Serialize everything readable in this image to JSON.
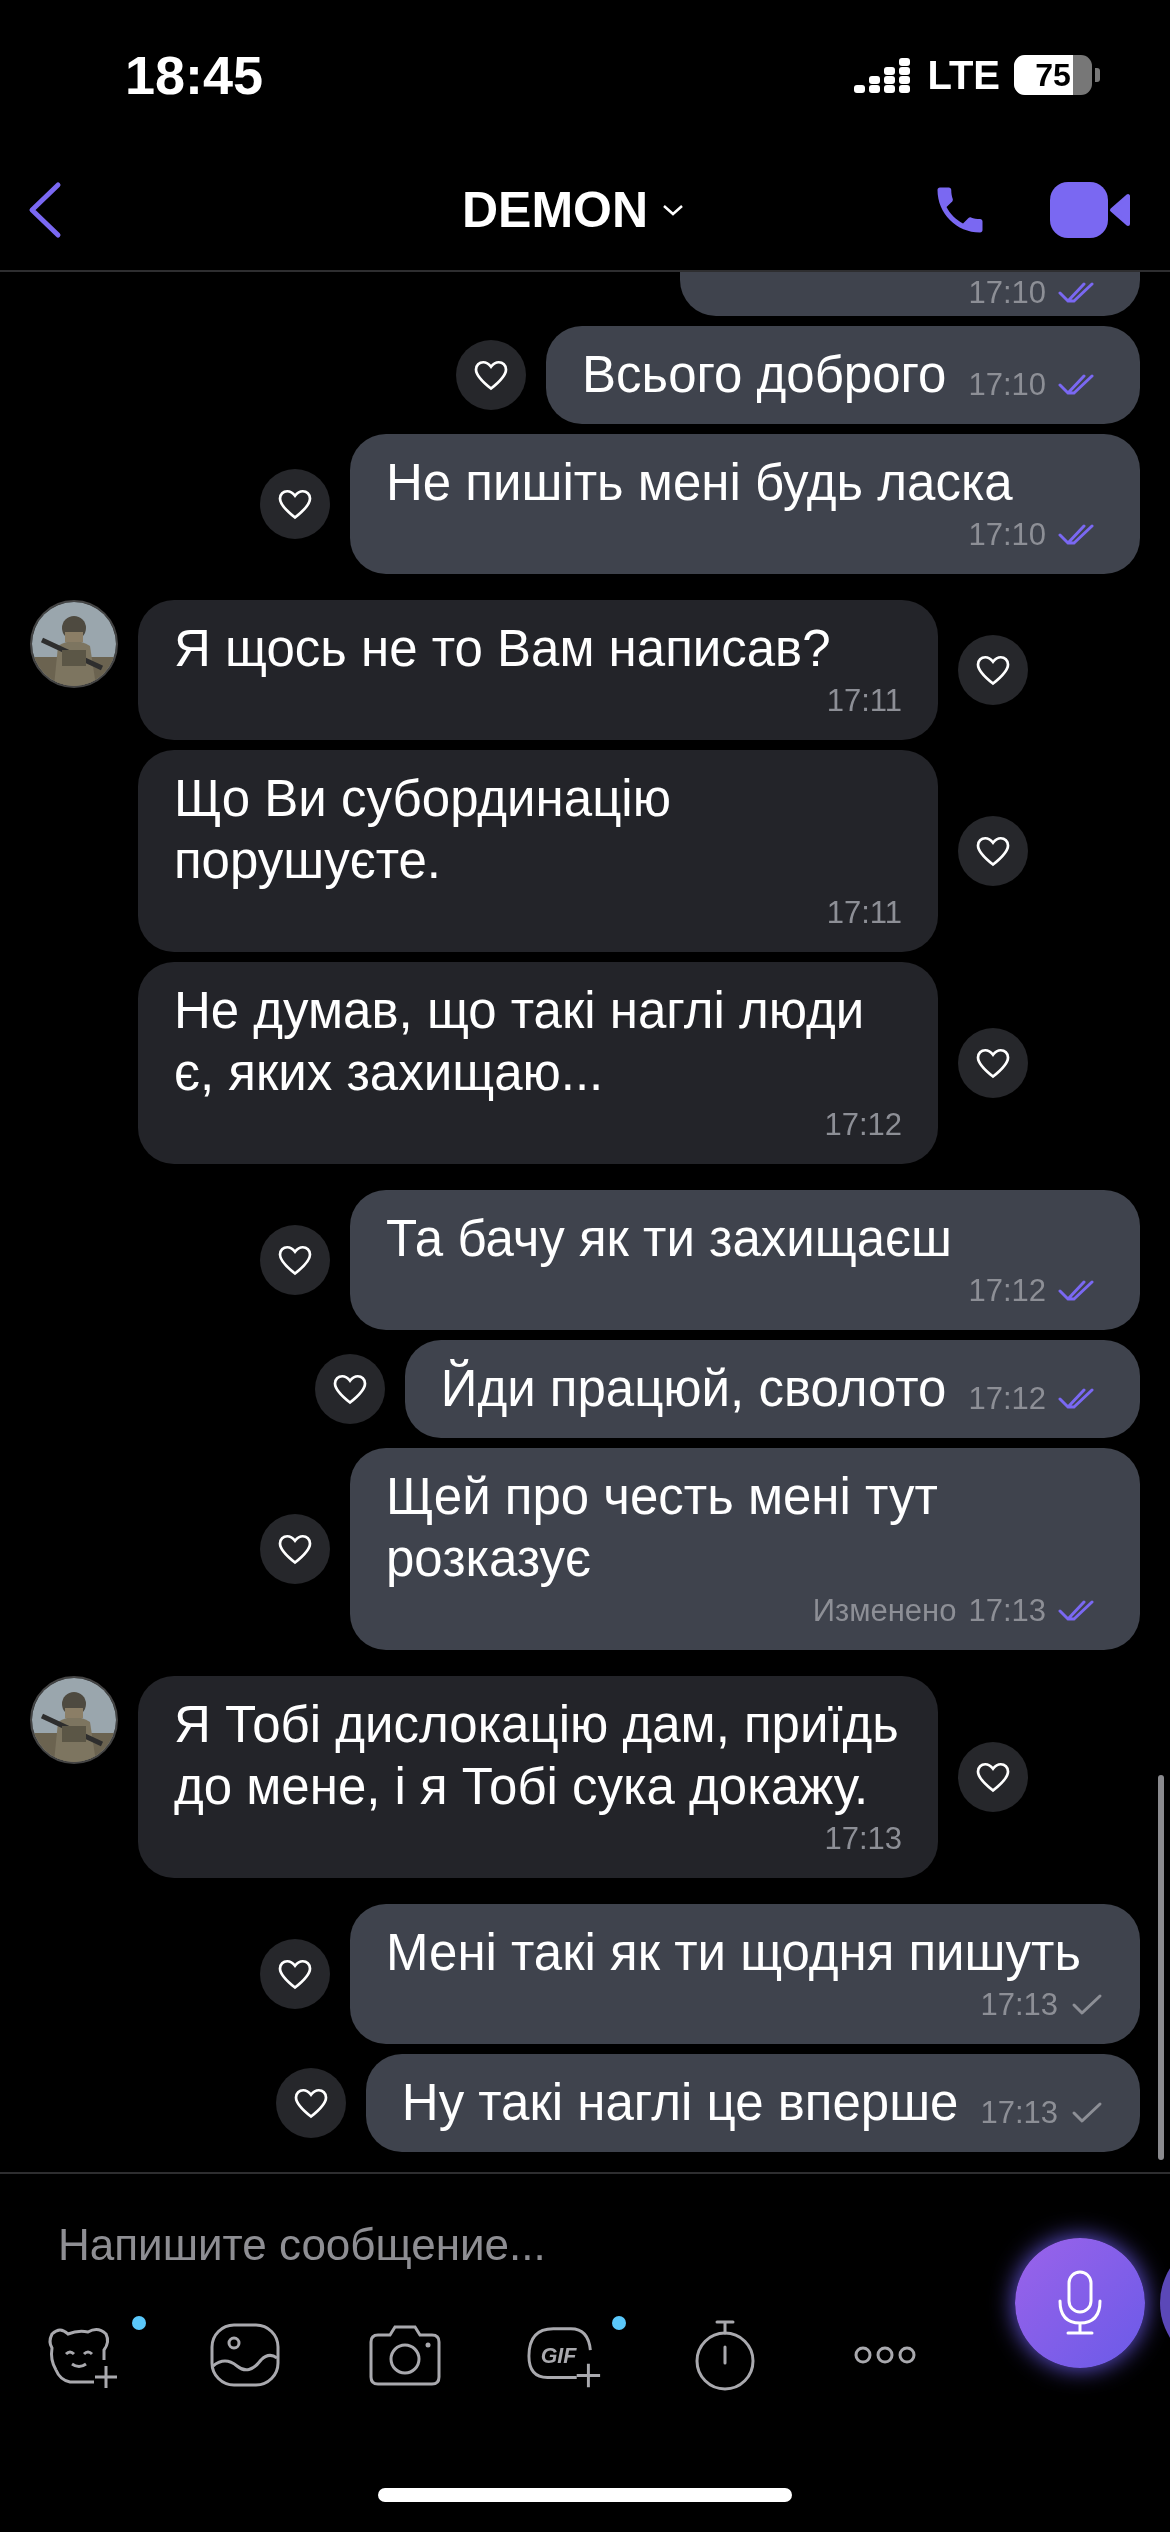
{
  "status_bar": {
    "time": "18:45",
    "network": "LTE",
    "battery": "75"
  },
  "header": {
    "title": "DEMON"
  },
  "messages": [
    {
      "kind": "outgoing",
      "cut_off": true,
      "time": "17:10",
      "read": true
    },
    {
      "kind": "outgoing",
      "cut_off": false,
      "text": "Всього доброго",
      "time": "17:10",
      "read": true
    },
    {
      "kind": "outgoing",
      "cut_off": false,
      "text": "Не пишіть мені будь ласка",
      "time": "17:10",
      "read": true
    },
    {
      "kind": "incoming",
      "cut_off": false,
      "avatar": true,
      "text": "Я щось не то Вам написав?",
      "time": "17:11"
    },
    {
      "kind": "incoming",
      "cut_off": false,
      "avatar": false,
      "text": "Що Ви субординацію порушуєте.",
      "time": "17:11"
    },
    {
      "kind": "incoming",
      "cut_off": false,
      "avatar": false,
      "text": "Не думав, що такі наглі люди є, яких захищаю...",
      "time": "17:12"
    },
    {
      "kind": "outgoing",
      "cut_off": false,
      "text": "Та бачу як ти захищаєш",
      "time": "17:12",
      "read": true
    },
    {
      "kind": "outgoing",
      "cut_off": false,
      "text": "Йди працюй, сволото",
      "time": "17:12",
      "read": true
    },
    {
      "kind": "outgoing",
      "cut_off": false,
      "text": "Щей про честь мені тут розказує",
      "edited_label": "Изменено",
      "time": "17:13",
      "read": true
    },
    {
      "kind": "incoming",
      "cut_off": false,
      "avatar": true,
      "text": "Я Тобі дислокацію дам, приїдь до мене, і я Тобі сука докажу.",
      "time": "17:13"
    },
    {
      "kind": "outgoing",
      "cut_off": false,
      "text": "Мені такі як ти щодня пишуть",
      "time": "17:13",
      "read": false
    },
    {
      "kind": "outgoing",
      "cut_off": false,
      "text": "Ну такі наглі це вперше",
      "time": "17:13",
      "read": false
    }
  ],
  "composer": {
    "placeholder": "Напишите сообщение...",
    "tools": [
      {
        "kind": "sticker",
        "has_new": true
      },
      {
        "kind": "gallery",
        "has_new": false
      },
      {
        "kind": "camera",
        "has_new": false
      },
      {
        "kind": "gif",
        "label": "GIF",
        "has_new": true
      },
      {
        "kind": "timer",
        "has_new": false
      },
      {
        "kind": "more",
        "has_new": false
      }
    ]
  }
}
